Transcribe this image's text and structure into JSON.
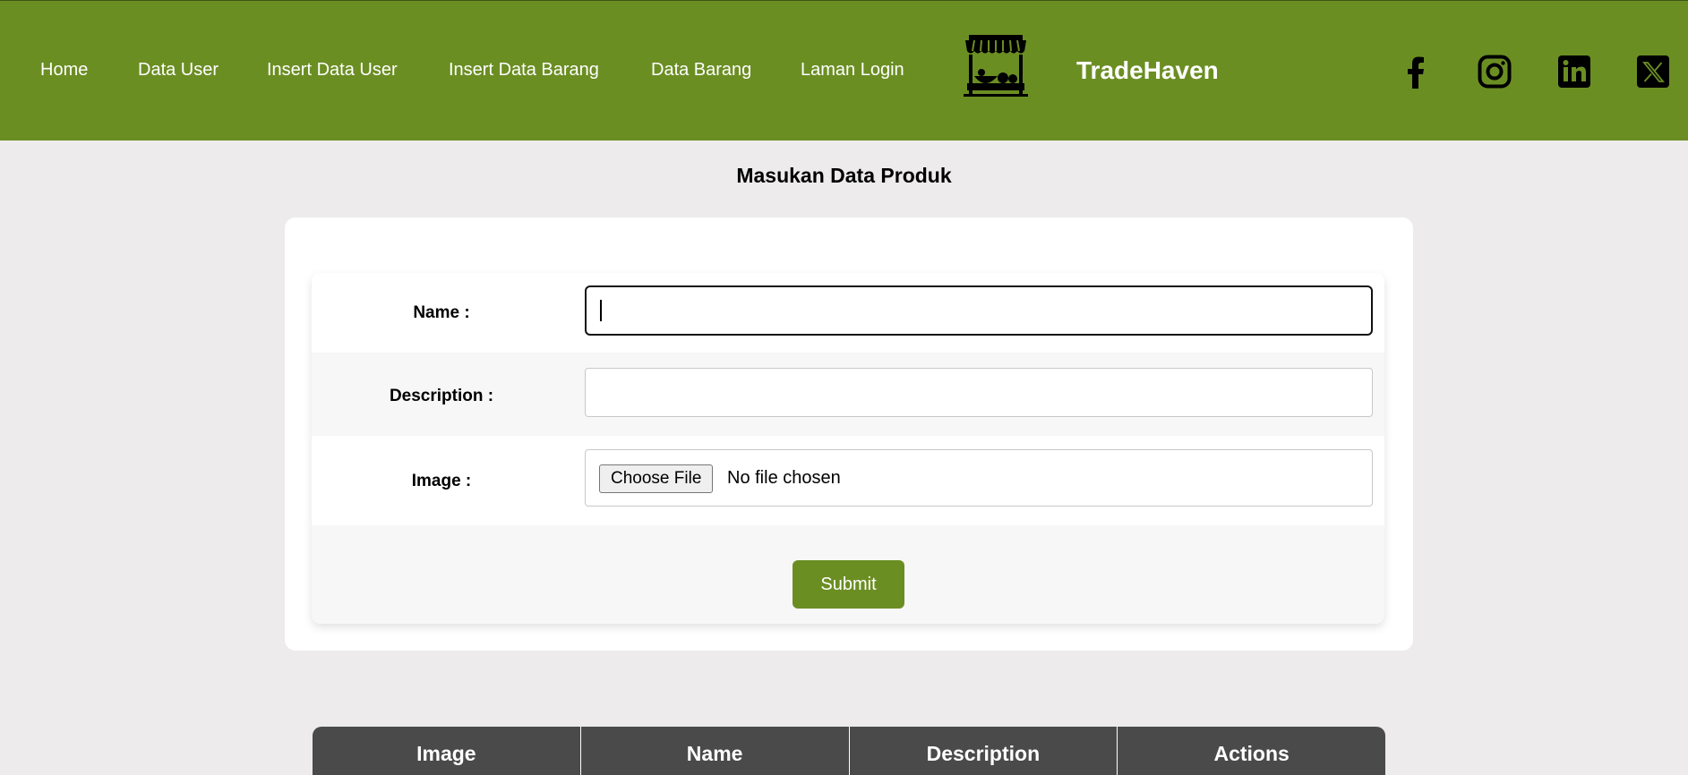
{
  "navbar": {
    "links": [
      "Home",
      "Data User",
      "Insert Data User",
      "Insert Data Barang",
      "Data Barang",
      "Laman Login"
    ],
    "brand": "TradeHaven",
    "logo_icon": "market-stall-icon",
    "social_icons": [
      "facebook-icon",
      "instagram-icon",
      "linkedin-icon",
      "x-icon"
    ],
    "background": "#6b8e23"
  },
  "page": {
    "title": "Masukan Data Produk"
  },
  "form": {
    "name_label": "Name :",
    "name_value": "",
    "description_label": "Description :",
    "description_value": "",
    "image_label": "Image :",
    "file_button": "Choose File",
    "file_status": "No file chosen",
    "submit_label": "Submit",
    "accent": "#6b8e23"
  },
  "table": {
    "headers": [
      "Image",
      "Name",
      "Description",
      "Actions"
    ],
    "header_background": "#4a4a4a"
  }
}
